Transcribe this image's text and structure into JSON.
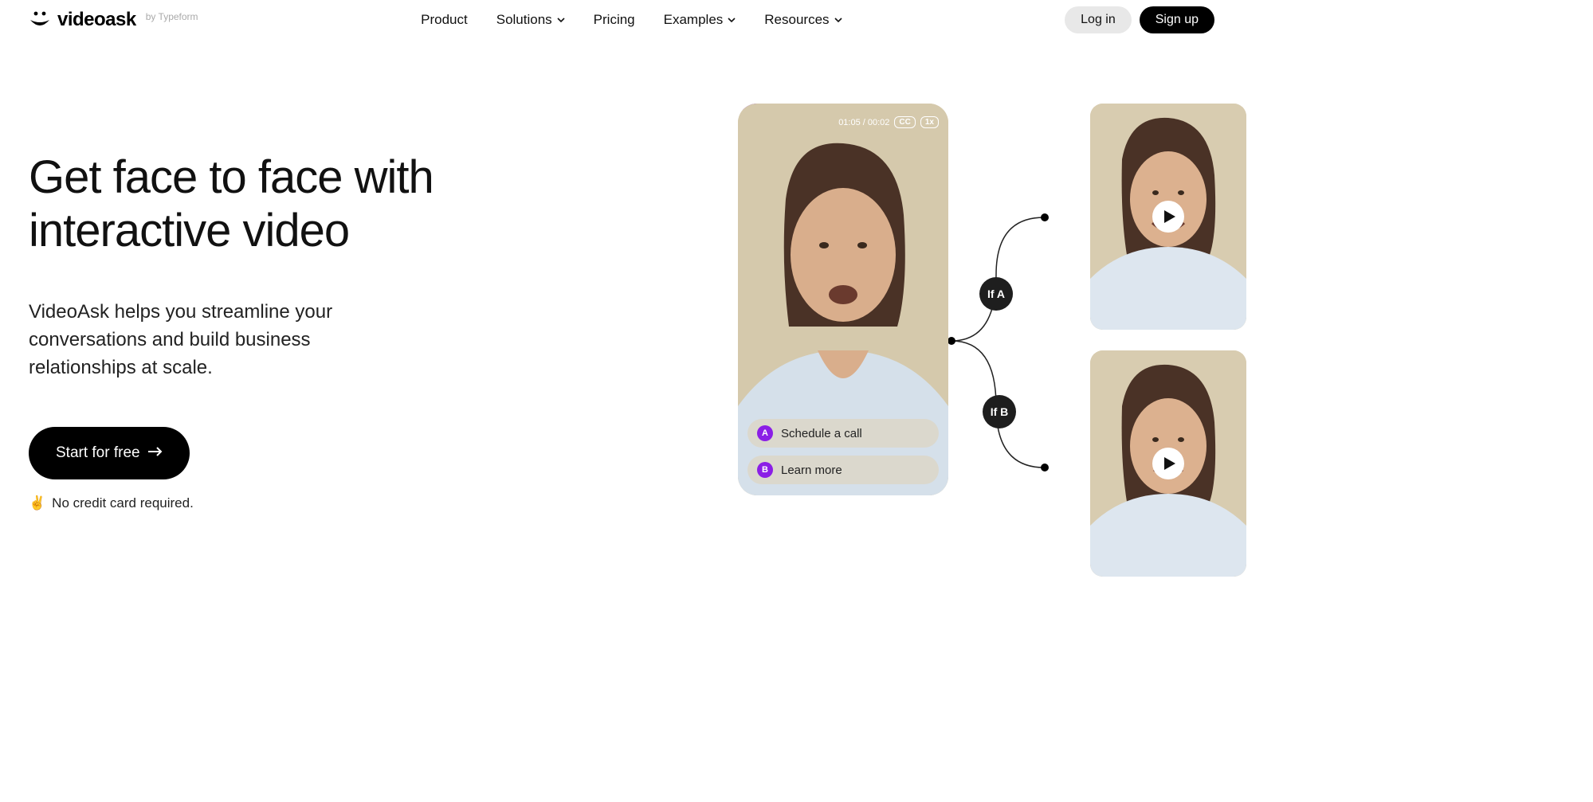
{
  "logo": {
    "text": "videoask",
    "byline": "by Typeform"
  },
  "nav": {
    "product": "Product",
    "solutions": "Solutions",
    "pricing": "Pricing",
    "examples": "Examples",
    "resources": "Resources"
  },
  "auth": {
    "login": "Log in",
    "signup": "Sign up"
  },
  "hero": {
    "title": "Get face to face with interactive video",
    "subtitle": "VideoAsk helps you streamline your conversations and build business relationships at scale.",
    "cta": "Start for free",
    "note": "No credit card required.",
    "peace_emoji": "✌️"
  },
  "video": {
    "time": "01:05 / 00:02",
    "cc": "CC",
    "speed": "1x",
    "options": [
      {
        "badge": "A",
        "label": "Schedule a call"
      },
      {
        "badge": "B",
        "label": "Learn more"
      }
    ]
  },
  "branch": {
    "a": "If A",
    "b": "If B"
  },
  "colors": {
    "accent": "#8b1ee6"
  }
}
